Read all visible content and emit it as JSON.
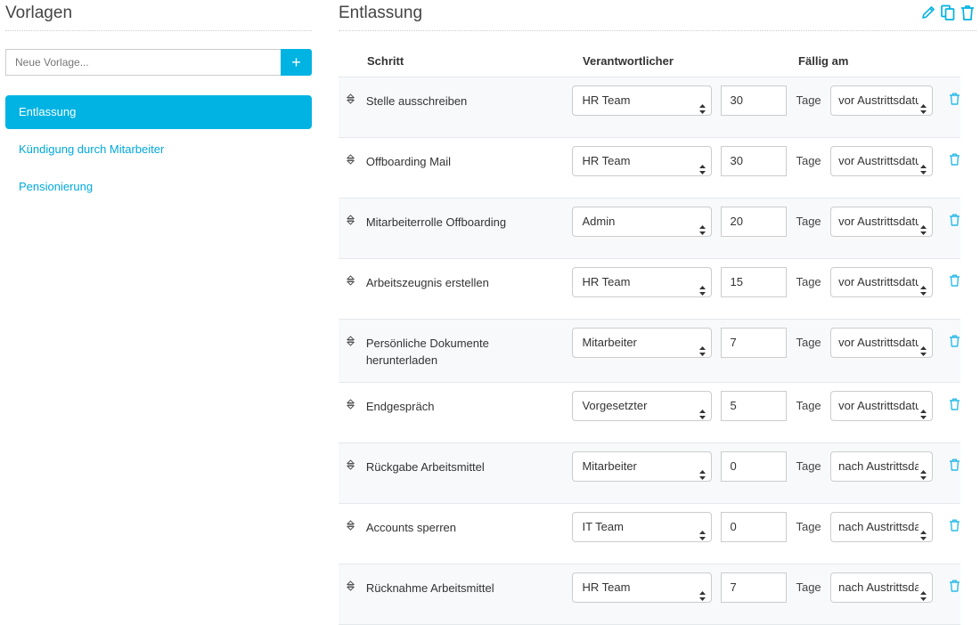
{
  "sidebar": {
    "title": "Vorlagen",
    "new_template_placeholder": "Neue Vorlage...",
    "add_button_label": "+",
    "templates": [
      {
        "label": "Entlassung",
        "active": true
      },
      {
        "label": "Kündigung durch Mitarbeiter",
        "active": false
      },
      {
        "label": "Pensionierung",
        "active": false
      }
    ]
  },
  "main": {
    "title": "Entlassung",
    "actions": [
      "pencil-icon",
      "copy-icon",
      "trash-icon"
    ],
    "columns": {
      "step": "Schritt",
      "responsible": "Verantwortlicher",
      "due": "Fällig am"
    },
    "unit_label": "Tage",
    "accent_color": "#00b3e3",
    "rows": [
      {
        "step": "Stelle ausschreiben",
        "responsible": "HR Team",
        "days": "30",
        "relation": "vor Austrittsdatum"
      },
      {
        "step": "Offboarding Mail",
        "responsible": "HR Team",
        "days": "30",
        "relation": "vor Austrittsdatum"
      },
      {
        "step": "Mitarbeiterrolle Offboarding",
        "responsible": "Admin",
        "days": "20",
        "relation": "vor Austrittsdatum"
      },
      {
        "step": "Arbeitszeugnis erstellen",
        "responsible": "HR Team",
        "days": "15",
        "relation": "vor Austrittsdatum"
      },
      {
        "step": "Persönliche Dokumente herunterladen",
        "responsible": "Mitarbeiter",
        "days": "7",
        "relation": "vor Austrittsdatum"
      },
      {
        "step": "Endgespräch",
        "responsible": "Vorgesetzter",
        "days": "5",
        "relation": "vor Austrittsdatum"
      },
      {
        "step": "Rückgabe Arbeitsmittel",
        "responsible": "Mitarbeiter",
        "days": "0",
        "relation": "nach Austrittsdatum"
      },
      {
        "step": "Accounts sperren",
        "responsible": "IT Team",
        "days": "0",
        "relation": "nach Austrittsdatum"
      },
      {
        "step": "Rücknahme Arbeitsmittel",
        "responsible": "HR Team",
        "days": "7",
        "relation": "nach Austrittsdatum"
      }
    ]
  }
}
